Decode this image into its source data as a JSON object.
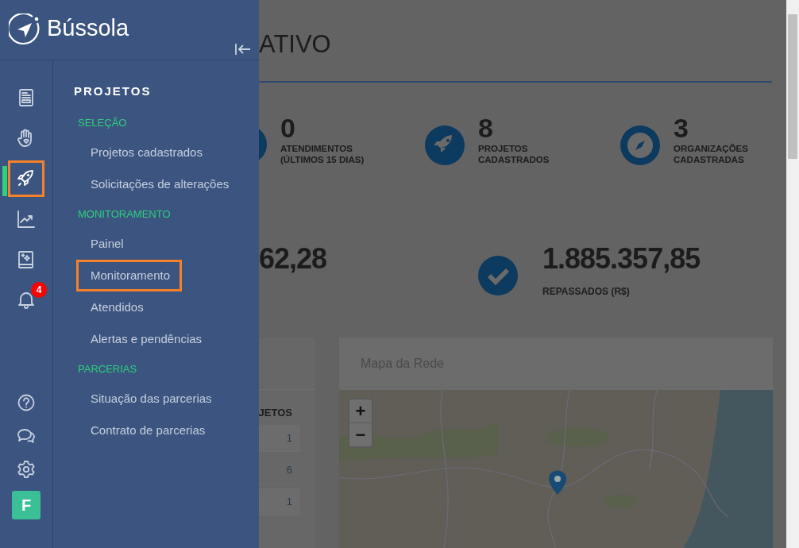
{
  "brand": {
    "name": "Bússola"
  },
  "rail": [
    {
      "kind": "document",
      "selected": false
    },
    {
      "kind": "hand",
      "selected": false
    },
    {
      "kind": "rocket",
      "selected": true
    },
    {
      "kind": "chart",
      "selected": false
    },
    {
      "kind": "book",
      "selected": false
    },
    {
      "kind": "bell",
      "selected": false,
      "badge": "4"
    }
  ],
  "rail_bottom": [
    {
      "kind": "help"
    },
    {
      "kind": "chat"
    },
    {
      "kind": "settings"
    }
  ],
  "avatar": "F",
  "menu": {
    "title": "PROJETOS",
    "sections": [
      {
        "label": "SELEÇÃO",
        "items": [
          {
            "label": "Projetos cadastrados",
            "selected": false
          },
          {
            "label": "Solicitações de alterações",
            "selected": false
          }
        ]
      },
      {
        "label": "MONITORAMENTO",
        "items": [
          {
            "label": "Painel",
            "selected": false
          },
          {
            "label": "Monitoramento",
            "selected": true
          },
          {
            "label": "Atendidos",
            "selected": false
          },
          {
            "label": "Alertas e pendências",
            "selected": false
          }
        ]
      },
      {
        "label": "PARCERIAS",
        "items": [
          {
            "label": "Situação das parcerias",
            "selected": false
          },
          {
            "label": "Contrato de parcerias",
            "selected": false
          }
        ]
      }
    ]
  },
  "main": {
    "title": "ATIVO",
    "stats": [
      {
        "kind": "partial",
        "value": "0",
        "label": "ATENDIMENTOS (ÚLTIMOS 15 DIAS)"
      },
      {
        "kind": "rocket",
        "value": "8",
        "label": "PROJETOS CADASTRADOS"
      },
      {
        "kind": "compass",
        "value": "3",
        "label": "ORGANIZAÇÕES CADASTRADAS"
      }
    ],
    "totals": [
      {
        "kind": "partial",
        "value": "62,28"
      },
      {
        "kind": "check",
        "value": "1.885.357,85",
        "label": "REPASSADOS (R$)"
      }
    ],
    "table": {
      "column": "JETOS",
      "rows": [
        "1",
        "6",
        "1"
      ]
    },
    "map": {
      "title": "Mapa da Rede",
      "zoom_in": "+",
      "zoom_out": "−",
      "kind": "picture"
    }
  }
}
